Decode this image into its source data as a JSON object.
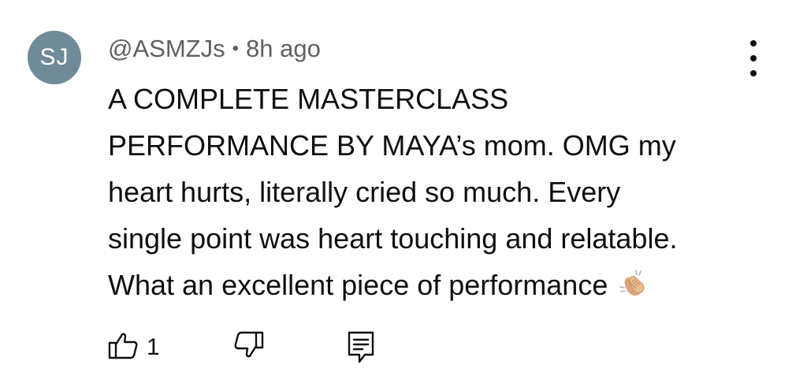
{
  "comment": {
    "avatar_initials": "SJ",
    "avatar_color": "#6f8a98",
    "author": "@ASMZJs",
    "separator": "•",
    "time": "8h ago",
    "text_lines": [
      "A COMPLETE MASTERCLASS",
      "PERFORMANCE BY MAYA’s mom. OMG my",
      "heart hurts, literally cried so much. Every",
      "single point was heart touching and relatable.",
      "What an excellent piece of performance"
    ],
    "emoji": "clapping-hands-icon",
    "like_count": "1"
  },
  "icons": {
    "more": "more-vertical-icon",
    "like": "thumbs-up-icon",
    "dislike": "thumbs-down-icon",
    "reply": "reply-comment-icon"
  }
}
